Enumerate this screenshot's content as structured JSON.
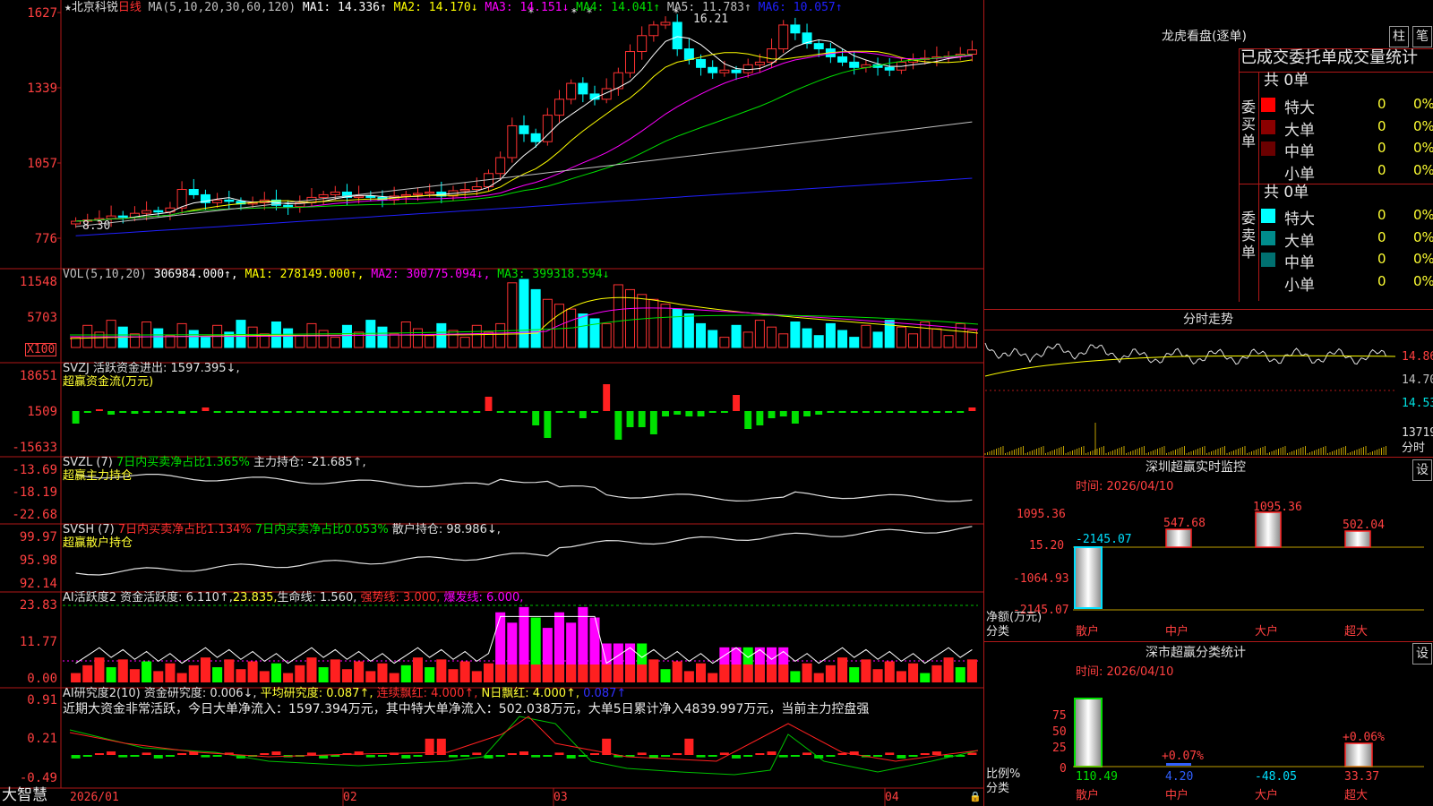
{
  "app": {
    "brand": "大智慧"
  },
  "main_chart": {
    "stock": "★北京科锐",
    "period": "日线",
    "ma_caption": "MA(5,10,20,30,60,120)",
    "ma_items": [
      {
        "label": "MA1: 14.336↑",
        "color": "#ffffff"
      },
      {
        "label": "MA2: 14.170↓",
        "color": "#ffff00"
      },
      {
        "label": "MA3: 14.151↓",
        "color": "#ff00ff"
      },
      {
        "label": "MA4: 14.041↑",
        "color": "#00e000"
      },
      {
        "label": "MA5: 11.783↑",
        "color": "#c0c0c0"
      },
      {
        "label": "MA6: 10.057↑",
        "color": "#2020ff"
      }
    ],
    "y_labels": [
      "1627",
      "1339",
      "1057",
      "776"
    ],
    "high_annotation": "16.21",
    "low_annotation": "8.30"
  },
  "volume_panel": {
    "caption": "VOL(5,10,20)",
    "items": [
      {
        "label": "306984.000↑,",
        "color": "#ffffff"
      },
      {
        "label": "MA1: 278149.000↑,",
        "color": "#ffff00"
      },
      {
        "label": "MA2: 300775.094↓,",
        "color": "#ff00ff"
      },
      {
        "label": "MA3: 399318.594↓",
        "color": "#00e000"
      }
    ],
    "y_labels": [
      "11548",
      "5703"
    ],
    "unit_label": "X100"
  },
  "svzj_panel": {
    "line1": "SVZJ  活跃资金进出: 1597.395↓,",
    "line2": "超赢资金流(万元)",
    "y_labels": [
      "18651",
      "1509",
      "-15633"
    ]
  },
  "svzl_panel": {
    "caption": "SVZL (7)",
    "item1": "7日内买卖净占比1.365%",
    "item2": "主力持仓: -21.685↑,",
    "line2": "超赢主力持仓",
    "y_labels": [
      "-13.69",
      "-18.19",
      "-22.68"
    ]
  },
  "svsh_panel": {
    "caption": "SVSH (7)",
    "item1": "7日内买卖净占比1.134%",
    "item2": "7日内买卖净占比0.053%",
    "item3": "散户持仓: 98.986↓,",
    "line2": "超赢散户持仓",
    "y_labels": [
      "99.97",
      "95.98",
      "92.14"
    ]
  },
  "ai_activity_panel": {
    "items": [
      {
        "label": "AI活跃度2 资金活跃度: 6.110↑,",
        "color": "#e0e0e0"
      },
      {
        "label": "23.835,",
        "color": "#ffff33"
      },
      {
        "label": "生命线: 1.560,",
        "color": "#e0e0e0"
      },
      {
        "label": "强势线: 3.000,",
        "color": "#ff3030"
      },
      {
        "label": "爆发线: 6.000,",
        "color": "#ff00ff"
      }
    ],
    "y_labels": [
      "23.83",
      "11.77",
      "0.00"
    ]
  },
  "ai_research_panel": {
    "items": [
      {
        "label": "AI研究度2(10) 资金研究度: 0.006↓,",
        "color": "#e0e0e0"
      },
      {
        "label": "平均研究度: 0.087↑,",
        "color": "#ffff33"
      },
      {
        "label": "连续飘红: 4.000↑,",
        "color": "#ff3030"
      },
      {
        "label": "N日飘红: 4.000↑,",
        "color": "#ffff33"
      },
      {
        "label": "0.087↑",
        "color": "#3030ff"
      }
    ],
    "summary": "近期大资金非常活跃，今日大单净流入：1597.394万元，其中特大单净流入：502.038万元，大单5日累计净入4839.997万元，当前主力控盘强",
    "y_labels": [
      "0.91",
      "0.21",
      "-0.49"
    ]
  },
  "x_axis": {
    "labels": [
      "2026/01",
      "02",
      "03",
      "04"
    ]
  },
  "dragon_tiger": {
    "title": "龙虎看盘(逐单)",
    "btn_bar": "柱",
    "btn_pen": "笔",
    "header": "已成交委托单成交量统计",
    "buy": {
      "side_label": "委买单",
      "total": "共 0单",
      "rows": [
        {
          "label": "特大",
          "count": "0",
          "pct": "0%",
          "color": "#ff0000"
        },
        {
          "label": "大单",
          "count": "0",
          "pct": "0%",
          "color": "#8b0000"
        },
        {
          "label": "中单",
          "count": "0",
          "pct": "0%",
          "color": "#6b0000"
        },
        {
          "label": "小单",
          "count": "0",
          "pct": "0%",
          "color": "#000000"
        }
      ]
    },
    "sell": {
      "side_label": "委卖单",
      "total": "共 0单",
      "rows": [
        {
          "label": "特大",
          "count": "0",
          "pct": "0%",
          "color": "#00ffff"
        },
        {
          "label": "大单",
          "count": "0",
          "pct": "0%",
          "color": "#008b8b"
        },
        {
          "label": "中单",
          "count": "0",
          "pct": "0%",
          "color": "#007070"
        },
        {
          "label": "小单",
          "count": "0",
          "pct": "0%",
          "color": "#000000"
        }
      ]
    }
  },
  "intraday": {
    "title": "分时走势",
    "y_labels": [
      "14.86",
      "14.70",
      "14.53"
    ],
    "vol_label": "13719",
    "footer": "分时"
  },
  "sz_monitor": {
    "title": "深圳超赢实时监控",
    "btn": "设",
    "time": "时间: 2026/04/10",
    "y_labels": [
      "1095.36",
      "15.20",
      "-1064.93",
      "-2145.07"
    ],
    "bars": [
      {
        "cat": "散户",
        "value": "-2145.07"
      },
      {
        "cat": "中户",
        "value": "547.68"
      },
      {
        "cat": "大户",
        "value": "1095.36"
      },
      {
        "cat": "超大",
        "value": "502.04"
      }
    ],
    "axis_label": "净额(万元)",
    "axis_label2": "分类"
  },
  "sz_category": {
    "title": "深市超赢分类统计",
    "btn": "设",
    "time": "时间: 2026/04/10",
    "y_labels": [
      "75",
      "50",
      "25",
      "0"
    ],
    "bars": [
      {
        "cat": "散户",
        "value": "110.49",
        "top": ""
      },
      {
        "cat": "中户",
        "value": "4.20",
        "top": "+0.07%"
      },
      {
        "cat": "大户",
        "value": "-48.05",
        "top": ""
      },
      {
        "cat": "超大",
        "value": "33.37",
        "top": "+0.06%"
      }
    ],
    "axis_label": "比例%",
    "axis_label2": "分类"
  },
  "chart_data": {
    "type": "candlestick",
    "title": "北京科锐 日线",
    "series": [
      {
        "name": "MA1",
        "value": 14.336
      },
      {
        "name": "MA2",
        "value": 14.17
      },
      {
        "name": "MA3",
        "value": 14.151
      },
      {
        "name": "MA4",
        "value": 14.041
      },
      {
        "name": "MA5",
        "value": 11.783
      },
      {
        "name": "MA6",
        "value": 10.057
      }
    ],
    "close": [
      8.4,
      8.45,
      8.5,
      8.6,
      8.55,
      8.7,
      8.8,
      8.75,
      8.9,
      9.6,
      9.4,
      9.1,
      9.2,
      9.15,
      9.05,
      9.1,
      9.2,
      9.0,
      8.95,
      9.1,
      9.3,
      9.4,
      9.5,
      9.3,
      9.35,
      9.3,
      9.2,
      9.35,
      9.4,
      9.45,
      9.5,
      9.35,
      9.55,
      9.6,
      9.7,
      10.2,
      10.8,
      12.0,
      11.7,
      11.4,
      12.4,
      13.0,
      13.6,
      13.2,
      13.0,
      13.4,
      14.0,
      14.8,
      15.4,
      15.8,
      15.9,
      14.9,
      14.5,
      14.2,
      14.0,
      14.1,
      14.0,
      14.3,
      14.4,
      14.9,
      15.8,
      15.5,
      15.1,
      14.9,
      14.6,
      14.4,
      14.2,
      14.3,
      14.2,
      14.1,
      14.4,
      14.5,
      14.55,
      14.6,
      14.62,
      14.7,
      14.86
    ],
    "ylim": [
      7.76,
      16.27
    ],
    "xlabel": "",
    "ylabel": ""
  }
}
